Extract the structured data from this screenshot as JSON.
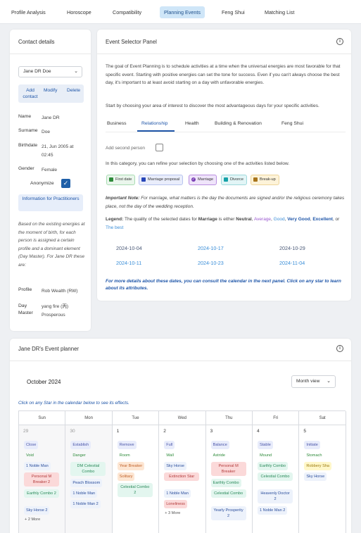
{
  "nav": {
    "tabs": [
      {
        "label": "Profile Analysis"
      },
      {
        "label": "Horoscope"
      },
      {
        "label": "Compatibility"
      },
      {
        "label": "Planning Events"
      },
      {
        "label": "Feng Shui"
      },
      {
        "label": "Matching List"
      }
    ],
    "active_tab": "Planning Events"
  },
  "contact": {
    "title": "Contact details",
    "selected_contact": "Jane DR Doe",
    "actions": {
      "add": "Add contact",
      "modify": "Modify",
      "delete": "Delete"
    },
    "fields": {
      "name_label": "Name",
      "name_value": "Jane DR",
      "surname_label": "Surname",
      "surname_value": "Doe",
      "birthdate_label": "Birthdate",
      "birthdate_value": "21, Jun 2005 at 02:45",
      "gender_label": "Gender",
      "gender_value": "Female",
      "anonymize_label": "Anonymize",
      "anonymize_checked": true
    },
    "info_button": "Information for Practitioners",
    "description": "Based on the existing energies at the moment of birth, for each person is assigned a certain profile and a dominant element (Day Master). For Jane DR these are:",
    "profile_label": "Profile",
    "profile_value": "Rob Wealth (RW)",
    "daymaster_label": "Day Master",
    "daymaster_value": "yang fire (丙) Prosperous"
  },
  "event_selector": {
    "title": "Event Selector Panel",
    "intro": "The goal of Event Planning is to schedule activities at a time when the universal energies are most favorable for that specific event. Starting with positive energies can set the tone for success. Even if you can't always choose the best day, it's important to at least avoid starting on a day with unfavorable energies.",
    "instruction": "Start by choosing your area of interest to discover the most advantageous days for your specific activities.",
    "tabs": [
      {
        "label": "Business"
      },
      {
        "label": "Relationship"
      },
      {
        "label": "Health"
      },
      {
        "label": "Building & Renovation"
      },
      {
        "label": "Feng Shui"
      }
    ],
    "active_tab": "Relationship",
    "add_second_person": "Add second person",
    "category_text": "In this category, you can refine your selection by choosing one of the activities listed below.",
    "activities": [
      {
        "label": "First date",
        "color": "#2e8b3a"
      },
      {
        "label": "Marriage proposal",
        "color": "#2746b8"
      },
      {
        "label": "Marriage",
        "color": "#7a3fb5"
      },
      {
        "label": "Divorce",
        "color": "#16a2a8"
      },
      {
        "label": "Break-up",
        "color": "#a8741a"
      }
    ],
    "selected_activity": "Marriage",
    "important_note_label": "Important Note:",
    "important_note": "For marriage, what matters is the day the documents are signed and/or the religious ceremony takes place, not the day of the wedding reception.",
    "legend": {
      "prefix": "Legend:",
      "text_a": "The quality of the selected dates for",
      "bold_event": "Marriage",
      "text_b": "is either",
      "neutral": "Neutral",
      "average": "Average",
      "good": "Good",
      "very_good": "Very Good",
      "excellent": "Excellent",
      "or": "or",
      "the_best": "The best"
    },
    "dates": [
      {
        "label": "2024-10-04",
        "quality": "neutral"
      },
      {
        "label": "2024-10-17",
        "quality": "good"
      },
      {
        "label": "2024-10-29",
        "quality": "neutral"
      },
      {
        "label": "2024-10-11",
        "quality": "good"
      },
      {
        "label": "2024-10-23",
        "quality": "good"
      },
      {
        "label": "2024-11-04",
        "quality": "good"
      }
    ],
    "footer_note": "For more details about these dates, you can consult the calendar in the next panel. Click on any star to learn about its attributes."
  },
  "planner": {
    "title": "Jane DR's Event planner",
    "month": "October 2024",
    "view": "Month view",
    "hint": "Click on any Star in the calendar below to see its effects.",
    "weekdays": [
      "Sun",
      "Mon",
      "Tue",
      "Wed",
      "Thu",
      "Fri",
      "Sat"
    ],
    "days": [
      {
        "num": "29",
        "grey": true,
        "tags": [
          {
            "t": "Close",
            "s": "officer"
          },
          {
            "t": "Void",
            "s": "green"
          },
          {
            "t": "1 Noble Man",
            "s": "blue"
          },
          {
            "t": "Personal M Breaker 2",
            "s": "red"
          },
          {
            "t": "Earthly Combo 2",
            "s": "teal"
          },
          {
            "t": "Sky Horse 2",
            "s": "blue"
          }
        ],
        "more": "+ 2 More"
      },
      {
        "num": "30",
        "grey": true,
        "tags": [
          {
            "t": "Establish",
            "s": "officer"
          },
          {
            "t": "Danger",
            "s": "green"
          },
          {
            "t": "DM Celestial Combo",
            "s": "teal"
          },
          {
            "t": "Peach Blossom",
            "s": "blue"
          },
          {
            "t": "1 Noble Man",
            "s": "blue"
          },
          {
            "t": "1 Noble Man 2",
            "s": "blue"
          }
        ]
      },
      {
        "num": "1",
        "grey": false,
        "tags": [
          {
            "t": "Remove",
            "s": "officer"
          },
          {
            "t": "Room",
            "s": "green"
          },
          {
            "t": "Year Breaker",
            "s": "orange"
          },
          {
            "t": "Solitary",
            "s": "orange"
          },
          {
            "t": "Celestial Combo 2",
            "s": "teal"
          }
        ]
      },
      {
        "num": "2",
        "grey": false,
        "tags": [
          {
            "t": "Full",
            "s": "officer"
          },
          {
            "t": "Wall",
            "s": "green"
          },
          {
            "t": "Sky Horse",
            "s": "blue"
          },
          {
            "t": "Extinction Star",
            "s": "red"
          },
          {
            "t": "1 Noble Man",
            "s": "blue"
          },
          {
            "t": "Loneliness",
            "s": "red"
          }
        ],
        "more": "+ 3 More"
      },
      {
        "num": "3",
        "grey": false,
        "tags": [
          {
            "t": "Balance",
            "s": "officer"
          },
          {
            "t": "Astride",
            "s": "green"
          },
          {
            "t": "Personal M Breaker",
            "s": "red"
          },
          {
            "t": "Earthly Combo",
            "s": "teal"
          },
          {
            "t": "Celestial Combo",
            "s": "teal"
          },
          {
            "t": "Yearly Prosperity 2",
            "s": "blue"
          }
        ]
      },
      {
        "num": "4",
        "grey": false,
        "tags": [
          {
            "t": "Stable",
            "s": "officer"
          },
          {
            "t": "Mound",
            "s": "green"
          },
          {
            "t": "Earthly Combo",
            "s": "teal"
          },
          {
            "t": "Celestial Combo",
            "s": "teal"
          },
          {
            "t": "Heavenly Doctor 2",
            "s": "blue"
          },
          {
            "t": "1 Noble Man 2",
            "s": "blue"
          }
        ]
      },
      {
        "num": "5",
        "grey": false,
        "tags": [
          {
            "t": "Initiate",
            "s": "officer"
          },
          {
            "t": "Stomach",
            "s": "green"
          },
          {
            "t": "Robbery Sha",
            "s": "yellow"
          },
          {
            "t": "Sky Horse",
            "s": "blue"
          }
        ]
      }
    ]
  }
}
